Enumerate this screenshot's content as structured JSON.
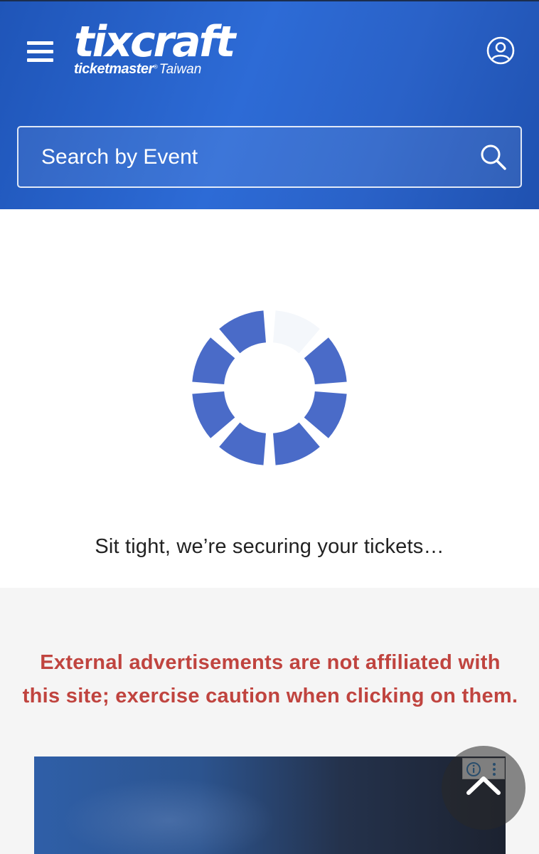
{
  "header": {
    "logo": {
      "main": "tixcraft",
      "sub": "ticketmaster",
      "registered": "®",
      "region": "Taiwan"
    },
    "menu_icon": "hamburger-menu-icon",
    "account_icon": "user-account-icon",
    "search": {
      "placeholder": "Search by Event",
      "icon": "search-icon"
    }
  },
  "loading": {
    "spinner_icon": "loading-spinner-icon",
    "message": "Sit tight, we’re securing your tickets…"
  },
  "ads": {
    "warning": "External advertisements are not affiliated with this site; exercise caution when clicking on them.",
    "adchoices_icon": "adchoices-info-icon",
    "back_to_top_icon": "chevron-up-icon"
  },
  "colors": {
    "header_blue": "#2a62c8",
    "spinner_blue": "#4a6bc8",
    "warning_red": "#c0443f",
    "ad_background": "#f5f5f5"
  }
}
